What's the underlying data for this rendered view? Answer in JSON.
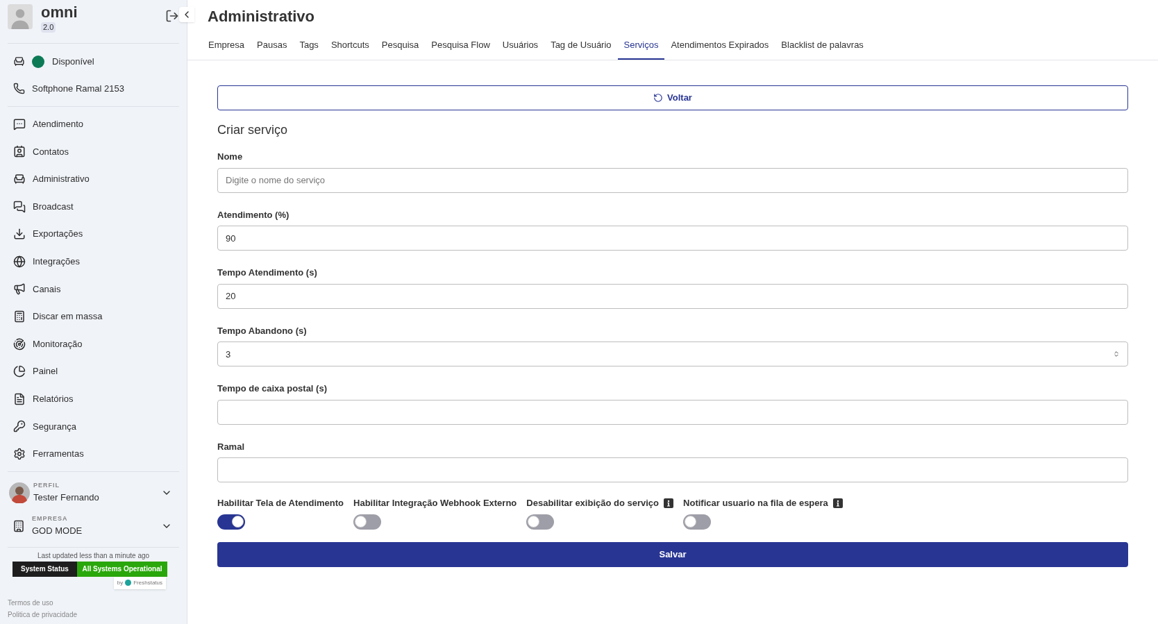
{
  "brand": {
    "name": "omni",
    "version": "2.0"
  },
  "status": {
    "label": "Disponível",
    "color": "#0b7a55"
  },
  "softphone": "Softphone Ramal 2153",
  "nav": [
    {
      "label": "Atendimento"
    },
    {
      "label": "Contatos"
    },
    {
      "label": "Administrativo"
    },
    {
      "label": "Broadcast"
    },
    {
      "label": "Exportações"
    },
    {
      "label": "Integrações"
    },
    {
      "label": "Canais"
    },
    {
      "label": "Discar em massa"
    },
    {
      "label": "Monitoração"
    },
    {
      "label": "Painel"
    },
    {
      "label": "Relatórios"
    },
    {
      "label": "Segurança"
    },
    {
      "label": "Ferramentas"
    }
  ],
  "profile": {
    "caption": "PERFIL",
    "name": "Tester Fernando"
  },
  "company": {
    "caption": "EMPRESA",
    "name": "GOD MODE"
  },
  "status_widget": {
    "updated": "Last updated less than a minute ago",
    "label": "System Status",
    "value": "All Systems Operational",
    "by": "by",
    "provider": "Freshstatus"
  },
  "footer_links": [
    "Termos de uso",
    "Politica de privacidade"
  ],
  "page_title": "Administrativo",
  "tabs": [
    {
      "label": "Empresa",
      "selected": false
    },
    {
      "label": "Pausas",
      "selected": false
    },
    {
      "label": "Tags",
      "selected": false
    },
    {
      "label": "Shortcuts",
      "selected": false
    },
    {
      "label": "Pesquisa",
      "selected": false
    },
    {
      "label": "Pesquisa Flow",
      "selected": false
    },
    {
      "label": "Usuários",
      "selected": false
    },
    {
      "label": "Tag de Usuário",
      "selected": false
    },
    {
      "label": "Serviços",
      "selected": true
    },
    {
      "label": "Atendimentos Expirados",
      "selected": false
    },
    {
      "label": "Blacklist de palavras",
      "selected": false
    }
  ],
  "back_button": "Voltar",
  "form_title": "Criar serviço",
  "fields": [
    {
      "label": "Nome",
      "kind": "text",
      "placeholder": "Digite o nome do serviço"
    },
    {
      "label": "Atendimento (%)",
      "kind": "text",
      "value": "90"
    },
    {
      "label": "Tempo Atendimento (s)",
      "kind": "text",
      "value": "20"
    },
    {
      "label": "Tempo Abandono (s)",
      "kind": "number",
      "value": "3"
    },
    {
      "label": "Tempo de caixa postal (s)",
      "kind": "text"
    },
    {
      "label": "Ramal",
      "kind": "text"
    }
  ],
  "toggles": [
    {
      "label": "Habilitar Tela de Atendimento",
      "on": true,
      "info": false
    },
    {
      "label": "Habilitar Integração Webhook Externo",
      "on": false,
      "info": false
    },
    {
      "label": "Desabilitar exibição do serviço",
      "on": false,
      "info": true
    },
    {
      "label": "Notificar usuario na fila de espera",
      "on": false,
      "info": true
    }
  ],
  "save_button": "Salvar"
}
